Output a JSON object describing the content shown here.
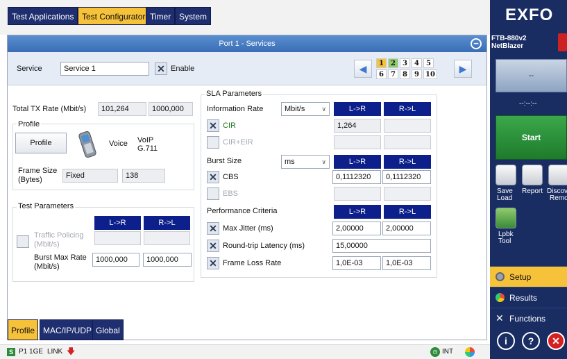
{
  "top_tabs": [
    {
      "label": "Test Applications",
      "active": false
    },
    {
      "label": "Test Configurator",
      "active": true
    },
    {
      "label": "Timer",
      "active": false
    },
    {
      "label": "System",
      "active": false
    }
  ],
  "panel": {
    "title": "Port 1 - Services"
  },
  "service": {
    "label": "Service",
    "value": "Service 1",
    "enable_label": "Enable",
    "enabled": true
  },
  "pager": {
    "row1": [
      "1",
      "2",
      "3",
      "4",
      "5"
    ],
    "row2": [
      "6",
      "7",
      "8",
      "9",
      "10"
    ],
    "active": "1",
    "configured": [
      "2"
    ]
  },
  "left": {
    "total_tx_label": "Total TX Rate (Mbit/s)",
    "total_tx_value": "101,264",
    "total_tx_max": "1000,000",
    "profile_group": "Profile",
    "profile_button": "Profile",
    "profile_type": "Voice",
    "profile_codec_1": "VoIP",
    "profile_codec_2": "G.711",
    "frame_size_label_1": "Frame Size",
    "frame_size_label_2": "(Bytes)",
    "frame_size_mode": "Fixed",
    "frame_size_value": "138",
    "test_params_group": "Test Parameters",
    "dir_lr": "L->R",
    "dir_rl": "R->L",
    "traffic_policing_1": "Traffic Policing",
    "traffic_policing_2": "(Mbit/s)",
    "burst_max_1": "Burst Max Rate",
    "burst_max_2": "(Mbit/s)",
    "burst_max_lr": "1000,000",
    "burst_max_rl": "1000,000"
  },
  "sla": {
    "group": "SLA Parameters",
    "info_rate_label": "Information Rate",
    "info_rate_unit": "Mbit/s",
    "dir_lr": "L->R",
    "dir_rl": "R->L",
    "cir_label": "CIR",
    "cir_lr": "1,264",
    "cir_eir_label": "CIR+EIR",
    "burst_size_label": "Burst Size",
    "burst_size_unit": "ms",
    "cbs_label": "CBS",
    "cbs_lr": "0,1112320",
    "cbs_rl": "0,1112320",
    "ebs_label": "EBS",
    "perf_label": "Performance Criteria",
    "max_jitter_label": "Max Jitter (ms)",
    "max_jitter_lr": "2,00000",
    "max_jitter_rl": "2,00000",
    "rtl_label": "Round-trip Latency (ms)",
    "rtl_value": "15,00000",
    "flr_label": "Frame Loss Rate",
    "flr_lr": "1,0E-03",
    "flr_rl": "1,0E-03"
  },
  "bottom_tabs": [
    {
      "label": "Profile",
      "active": true
    },
    {
      "label": "MAC/IP/UDP",
      "active": false
    },
    {
      "label": "Global",
      "active": false
    }
  ],
  "status": {
    "port": "P1 1GE",
    "link": "LINK",
    "int": "INT"
  },
  "sidebar": {
    "brand": "EXFO",
    "device_1": "FTB-880v2",
    "device_2": "NetBlazer",
    "display_value": "--",
    "timer": "--:--:--",
    "start": "Start",
    "save_load_1": "Save",
    "save_load_2": "Load",
    "report": "Report",
    "discover_1": "Discove",
    "discover_2": "Remot",
    "lpbk_1": "Lpbk",
    "lpbk_2": "Tool",
    "menu": [
      "Setup",
      "Results",
      "Functions"
    ],
    "active_menu": "Setup"
  },
  "colors": {
    "accent": "#f6c23a",
    "nav": "#1e2e6e",
    "dir_header": "#0d1f8a",
    "start": "#2e8b3a",
    "sidebar": "#1a2d63"
  }
}
